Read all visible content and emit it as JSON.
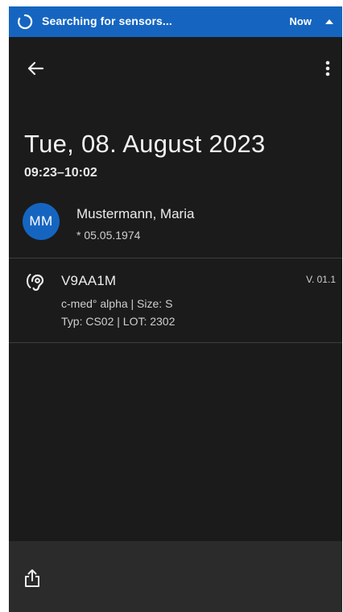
{
  "notification": {
    "text": "Searching for sensors...",
    "time": "Now",
    "spinner_icon": "progress-spinner-icon",
    "expand_icon": "caret-up-icon"
  },
  "app_bar": {
    "back_icon": "arrow-back-icon",
    "menu_icon": "more-vert-icon"
  },
  "session": {
    "date": "Tue, 08. August 2023",
    "time_range": "09:23–10:02"
  },
  "patient": {
    "initials": "MM",
    "name": "Mustermann, Maria",
    "birthdate": "* 05.05.1974"
  },
  "sensor": {
    "icon": "hearing-icon",
    "id": "V9AA1M",
    "version": "V. 01.1",
    "model_line": "c-med° alpha | Size: S",
    "type_line": "Typ: CS02 | LOT: 2302"
  },
  "bottom_bar": {
    "share_icon": "share-icon"
  },
  "colors": {
    "accent": "#1565c0",
    "background": "#1b1b1b",
    "bottom_bar": "#2b2b2b",
    "divider": "#3e3e3e"
  }
}
